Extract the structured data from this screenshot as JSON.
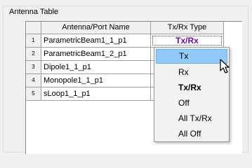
{
  "group": {
    "title": "Antenna Table"
  },
  "table": {
    "headers": {
      "name": "Antenna/Port Name",
      "type": "Tx/Rx Type"
    },
    "rows": [
      {
        "num": "1",
        "name": "ParametricBeam1_1_p1",
        "type": "Tx/Rx"
      },
      {
        "num": "2",
        "name": "ParametricBeam1_2_p1",
        "type": ""
      },
      {
        "num": "3",
        "name": "Dipole1_1_p1",
        "type": ""
      },
      {
        "num": "4",
        "name": "Monopole1_1_p1",
        "type": ""
      },
      {
        "num": "5",
        "name": "sLoop1_1_p1",
        "type": ""
      }
    ]
  },
  "menu": {
    "items": [
      {
        "label": "Tx",
        "highlighted": true
      },
      {
        "label": "Rx"
      },
      {
        "label": "Tx/Rx",
        "bold": true
      },
      {
        "label": "Off"
      },
      {
        "label": "All Tx/Rx"
      },
      {
        "label": "All Off"
      }
    ]
  },
  "colors": {
    "active_type_text": "#6a0dad",
    "menu_highlight": "#91c9f7"
  },
  "icons": {
    "cursor": "arrow-cursor-icon"
  }
}
